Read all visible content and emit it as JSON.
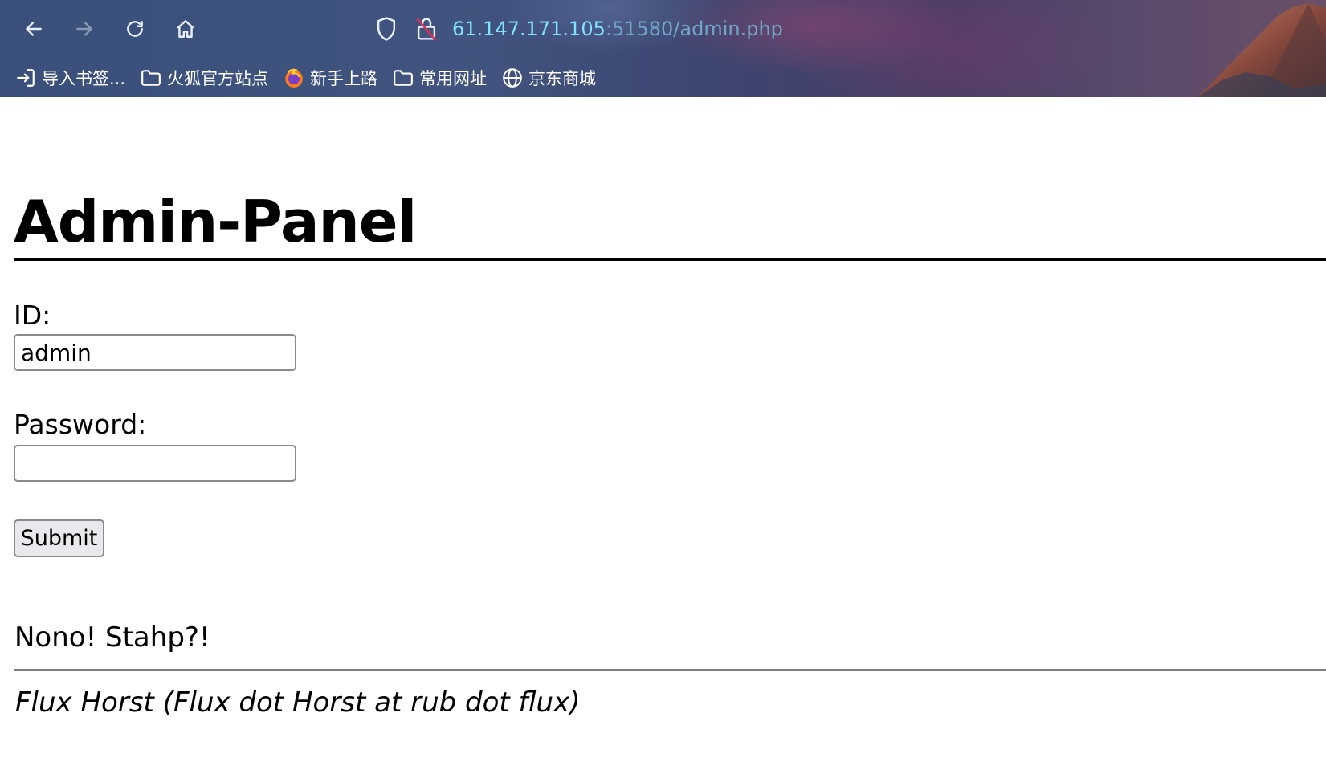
{
  "browser": {
    "url_host": "61.147.171.105",
    "url_rest": ":51580/admin.php",
    "nav": {
      "back_icon": "back-arrow-icon",
      "forward_icon": "forward-arrow-icon",
      "reload_icon": "reload-icon",
      "home_icon": "home-icon"
    },
    "bookmarks": [
      {
        "label": "导入书签...",
        "icon": "import-icon"
      },
      {
        "label": "火狐官方站点",
        "icon": "folder-icon"
      },
      {
        "label": "新手上路",
        "icon": "firefox-icon"
      },
      {
        "label": "常用网址",
        "icon": "folder-icon"
      },
      {
        "label": "京东商城",
        "icon": "globe-icon"
      }
    ],
    "colors": {
      "url_host": "#7fe3ff",
      "url_rest": "#6fa6c8"
    }
  },
  "page": {
    "title": "Admin-Panel",
    "id_label": "ID:",
    "id_value": "admin",
    "password_label": "Password:",
    "password_value": "",
    "submit_label": "Submit",
    "status_message": "Nono! Stahp?!",
    "footer_author": "Flux Horst (Flux dot Horst at rub dot flux)"
  }
}
